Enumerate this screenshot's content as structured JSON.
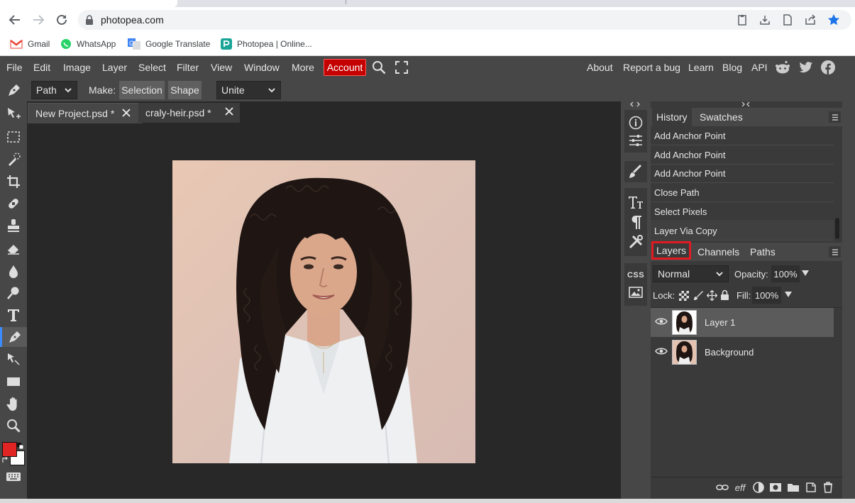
{
  "browser": {
    "url": "photopea.com",
    "bookmarks": [
      {
        "label": "Gmail",
        "icon": "gmail-icon"
      },
      {
        "label": "WhatsApp",
        "icon": "whatsapp-icon"
      },
      {
        "label": "Google Translate",
        "icon": "google-translate-icon"
      },
      {
        "label": "Photopea | Online...",
        "icon": "photopea-icon"
      }
    ]
  },
  "menubar": {
    "items": [
      "File",
      "Edit",
      "Image",
      "Layer",
      "Select",
      "Filter",
      "View",
      "Window",
      "More"
    ],
    "account": "Account",
    "right_links": [
      "About",
      "Report a bug",
      "Learn",
      "Blog",
      "API"
    ]
  },
  "options": {
    "tool_mode": "Path",
    "make_label": "Make:",
    "selection_btn": "Selection",
    "shape_btn": "Shape",
    "combine_mode": "Unite"
  },
  "documents": {
    "tabs": [
      {
        "label": "New Project.psd *"
      },
      {
        "label": "craly-heir.psd *"
      }
    ]
  },
  "history_panel": {
    "tabs": [
      "History",
      "Swatches"
    ],
    "items": [
      "Add Anchor Point",
      "Add Anchor Point",
      "Add Anchor Point",
      "Close Path",
      "Select Pixels",
      "Layer Via Copy"
    ]
  },
  "layers_panel": {
    "tabs": [
      "Layers",
      "Channels",
      "Paths"
    ],
    "blend_mode": "Normal",
    "opacity_label": "Opacity:",
    "opacity": "100%",
    "lock_label": "Lock:",
    "fill_label": "Fill:",
    "fill": "100%",
    "layers": [
      {
        "name": "Layer 1",
        "selected": true
      },
      {
        "name": "Background",
        "selected": false
      }
    ]
  },
  "mini_panel": {
    "css_label": "CSS"
  },
  "colors": {
    "foreground": "#e02424",
    "background": "#ffffff",
    "accent": "#c40000",
    "highlight": "#e21b23"
  }
}
